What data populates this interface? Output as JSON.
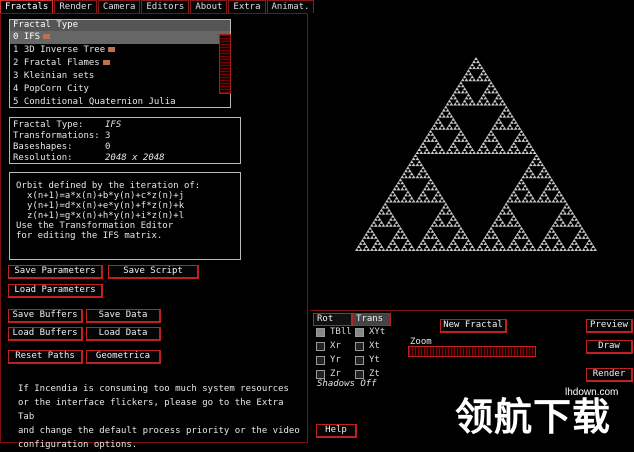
{
  "tabs": [
    "Fractals",
    "Render",
    "Camera",
    "Editors",
    "About",
    "Extra",
    "Animat."
  ],
  "fractal_type": {
    "header": "Fractal Type",
    "items": [
      "0 IFS",
      "1 3D Inverse Tree",
      "2 Fractal Flames",
      "3 Kleinian sets",
      "4 PopCorn City",
      "5 Conditional Quaternion Julia"
    ]
  },
  "info": {
    "rows": [
      {
        "label": "Fractal Type:",
        "value": "IFS"
      },
      {
        "label": "Transformations:",
        "value": "3"
      },
      {
        "label": "Baseshapes:",
        "value": "0"
      },
      {
        "label": "Resolution:",
        "value": "2048 x 2048"
      }
    ]
  },
  "description": [
    "Orbit defined by the iteration of:",
    "x(n+1)=a*x(n)+b*y(n)+c*z(n)+j",
    "y(n+1)=d*x(n)+e*y(n)+f*z(n)+k",
    "z(n+1)=g*x(n)+h*y(n)+i*z(n)+l",
    "Use the Transformation Editor",
    "for editing the IFS matrix."
  ],
  "buttons": {
    "save_parameters": "Save Parameters",
    "save_script": "Save Script",
    "load_parameters": "Load Parameters",
    "save_buffers": "Save Buffers",
    "save_data": "Save Data",
    "load_buffers": "Load Buffers",
    "load_data": "Load Data",
    "reset_paths": "Reset Paths",
    "geometrica": "Geometrica",
    "new_fractal": "New Fractal",
    "preview": "Preview",
    "draw": "Draw",
    "render": "Render",
    "help": "Help"
  },
  "notice": [
    "If Incendia is consuming too much system resources",
    "or the interface flickers, please go to the Extra Tab",
    "and change the default process priority or the video",
    "configuration options."
  ],
  "controls": {
    "rot": "Rot",
    "trans": "Trans",
    "rot_items": [
      "TBll",
      "Xr",
      "Yr",
      "Zr"
    ],
    "trans_items": [
      "XYt",
      "Xt",
      "Yt",
      "Zt"
    ],
    "shadows": "Shadows Off",
    "zoom": "Zoom"
  },
  "watermark": {
    "chinese": "领航下载",
    "url": "lhdown.com"
  }
}
